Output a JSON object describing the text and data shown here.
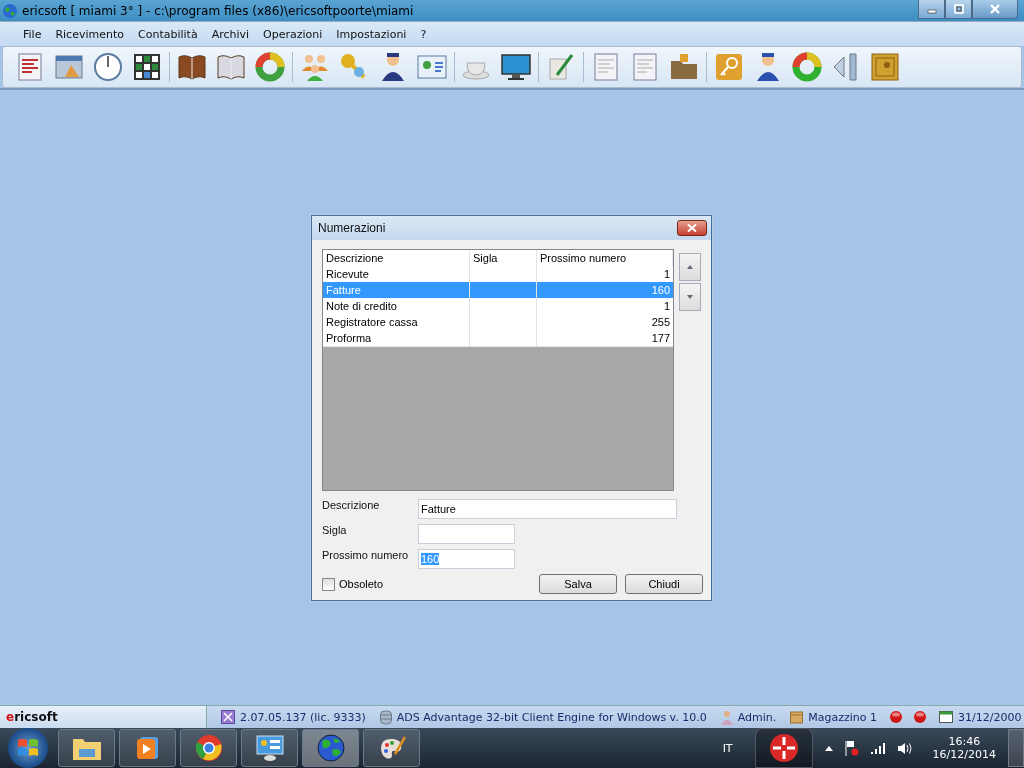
{
  "window": {
    "title": "ericsoft [ miami 3° ] - c:\\program files (x86)\\ericsoftpoorte\\miami"
  },
  "menu": [
    "File",
    "Ricevimento",
    "Contabilità",
    "Archivi",
    "Operazioni",
    "Impostazioni",
    "?"
  ],
  "dialog": {
    "title": "Numerazioni",
    "table": {
      "columns": [
        "Descrizione",
        "Sigla",
        "Prossimo numero"
      ],
      "rows": [
        {
          "descrizione": "Ricevute",
          "prossimo_numero": "1",
          "selected": false
        },
        {
          "descrizione": "Fatture",
          "prossimo_numero": "160",
          "selected": true
        },
        {
          "descrizione": "Note di credito",
          "prossimo_numero": "1",
          "selected": false
        },
        {
          "descrizione": "Registratore cassa",
          "prossimo_numero": "255",
          "selected": false
        },
        {
          "descrizione": "Proforma",
          "prossimo_numero": "177",
          "selected": false
        }
      ]
    },
    "fields": [
      {
        "label": "Descrizione",
        "value": "Fatture",
        "kind": "wide"
      },
      {
        "label": "Sigla",
        "kind": "short"
      },
      {
        "label": "Prossimo numero",
        "value": "160",
        "kind": "short",
        "text_selected": true
      }
    ],
    "checkbox": {
      "label": "Obsoleto",
      "checked": false
    },
    "buttons": [
      "Salva",
      "Chiudi"
    ]
  },
  "status_bar": {
    "app": "ericsoft",
    "version": "2.07.05.137 (lic. 9333)",
    "engine": "ADS Advantage 32-bit Client Engine for Windows v. 10.0",
    "user": "Admin.",
    "warehouse": "Magazzino 1",
    "date": "31/12/2000"
  },
  "taskbar": {
    "language": "IT",
    "time": "16:46",
    "date": "16/12/2014"
  }
}
